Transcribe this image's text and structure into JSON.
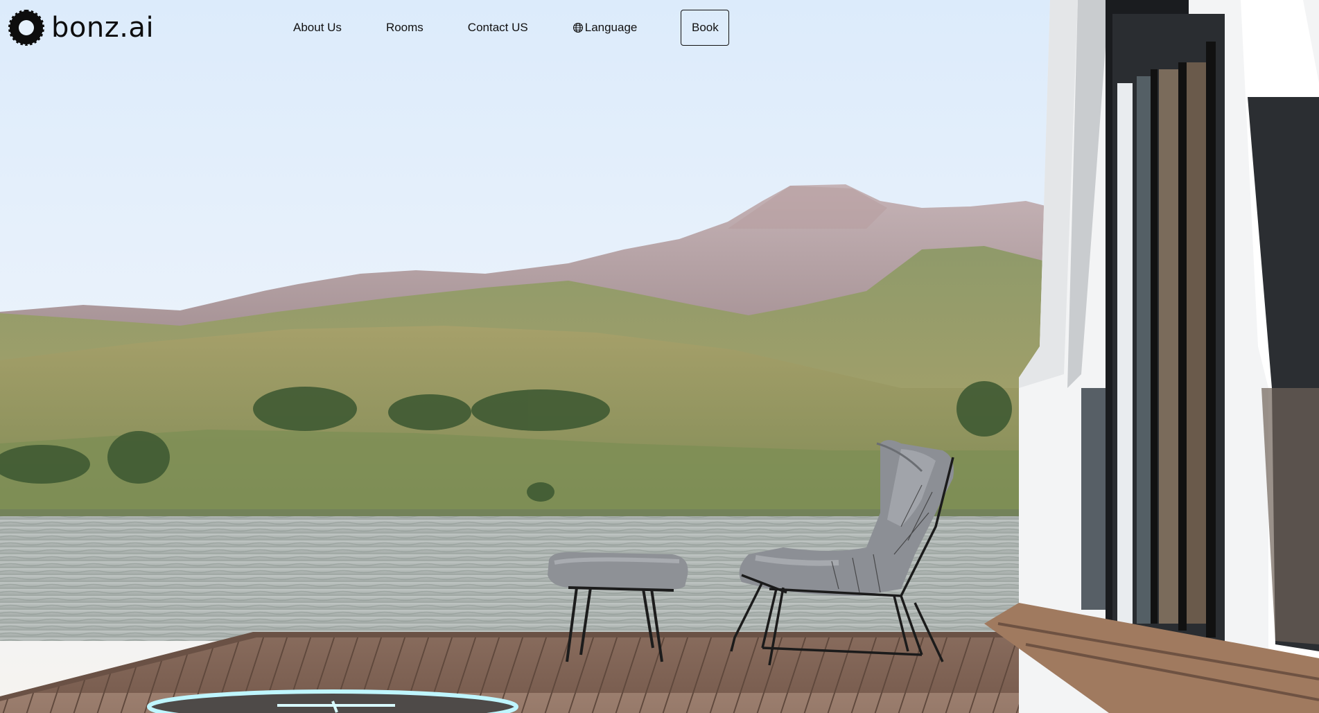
{
  "brand": {
    "name": "bonz.ai",
    "logo_icon": "gear-ring-logo"
  },
  "nav": {
    "about": "About Us",
    "rooms": "Rooms",
    "contact": "Contact US",
    "language": "Language",
    "language_icon": "globe-icon",
    "book": "Book"
  },
  "hero": {
    "scene": "lakeside-deck-with-lounge-chairs-and-mountains",
    "colors": {
      "sky_top": "#dcebfb",
      "water": "#a9b2b0",
      "deck": "#8e7060",
      "accent_ring": "#bff6ff"
    }
  }
}
